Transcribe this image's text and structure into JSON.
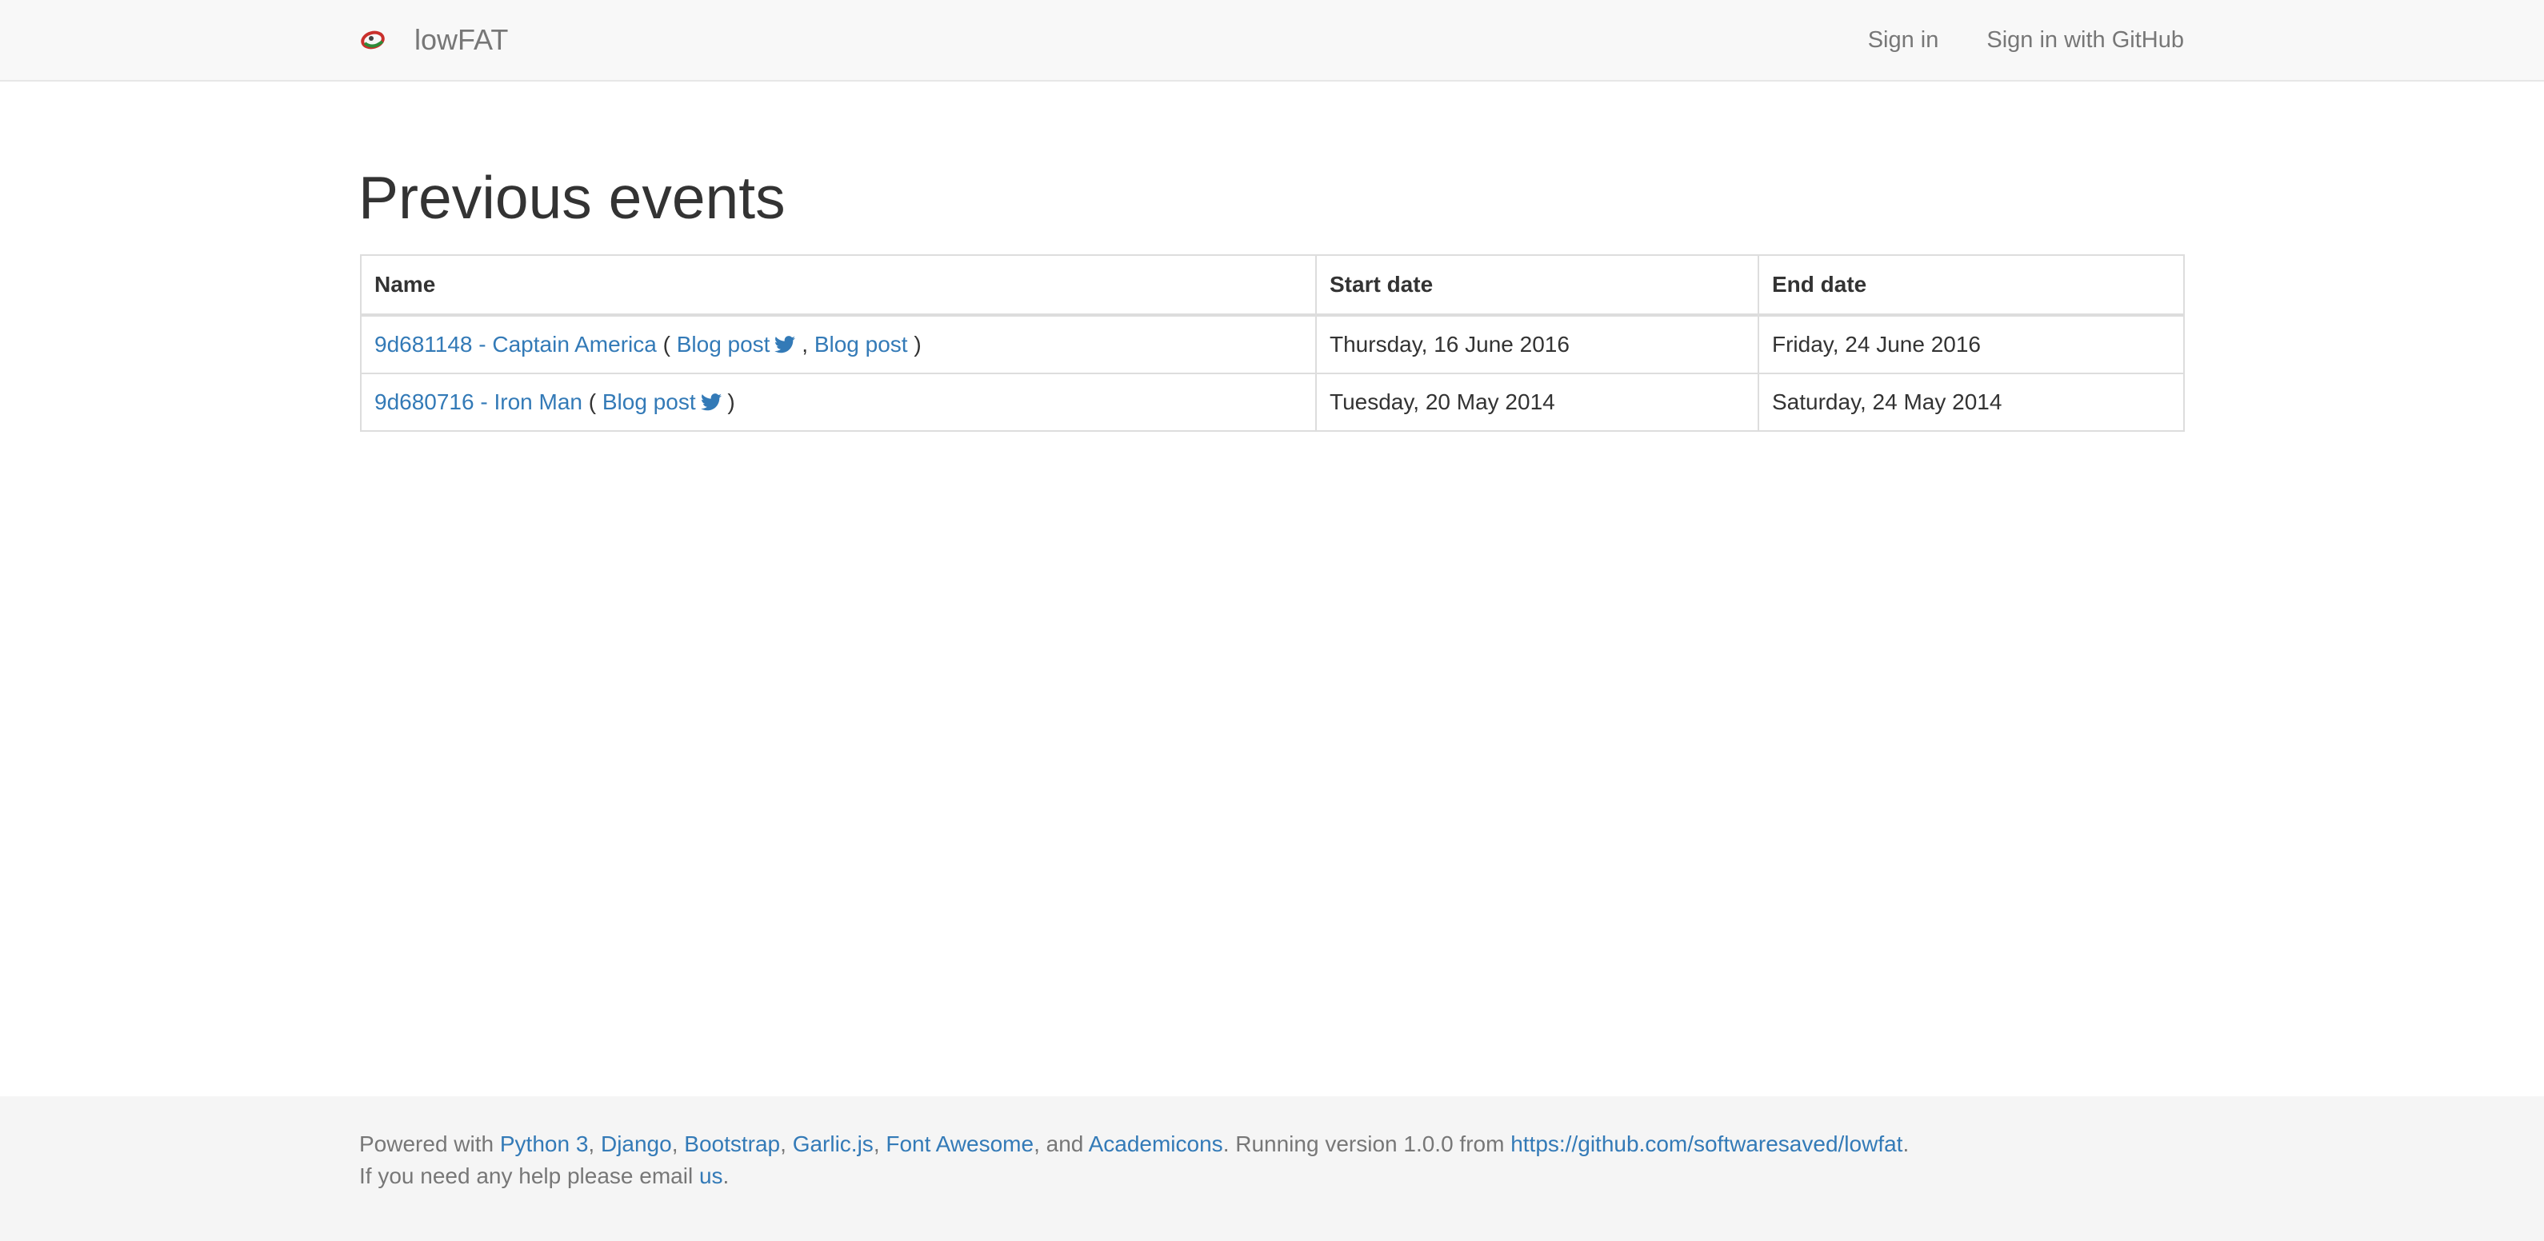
{
  "navbar": {
    "brand_name": "lowFAT",
    "links": [
      "Sign in",
      "Sign in with GitHub"
    ]
  },
  "main": {
    "title": "Previous events",
    "table": {
      "headers": [
        "Name",
        "Start date",
        "End date"
      ],
      "rows": [
        {
          "event_link": "9d681148 - Captain America",
          "open_paren": "(",
          "blog_post_1": "Blog post",
          "separator": ",",
          "blog_post_2": "Blog post",
          "close_paren": ")",
          "start_date": "Thursday, 16 June 2016",
          "end_date": "Friday, 24 June 2016"
        },
        {
          "event_link": "9d680716 - Iron Man",
          "open_paren": "(",
          "blog_post_1": "Blog post",
          "close_paren": ")",
          "start_date": "Tuesday, 20 May 2014",
          "end_date": "Saturday, 24 May 2014"
        }
      ]
    }
  },
  "footer": {
    "powered_prefix": "Powered with ",
    "tech_links": [
      "Python 3",
      "Django",
      "Bootstrap",
      "Garlic.js",
      "Font Awesome",
      "Academicons"
    ],
    "sep_comma": ", ",
    "sep_and": ", and ",
    "running_text": ". Running version 1.0.0 from ",
    "repo_link": "https://github.com/softwaresaved/lowfat",
    "period": ".",
    "help_text": "If you need any help please email ",
    "help_link": "us",
    "help_period": "."
  },
  "colors": {
    "link": "#337ab7",
    "navbar_bg": "#f8f8f8",
    "footer_bg": "#f5f5f5",
    "muted_text": "#777777",
    "body_text": "#333333"
  },
  "icons": {
    "brand": "lowfat-logo-icon",
    "social": "twitter-icon"
  }
}
